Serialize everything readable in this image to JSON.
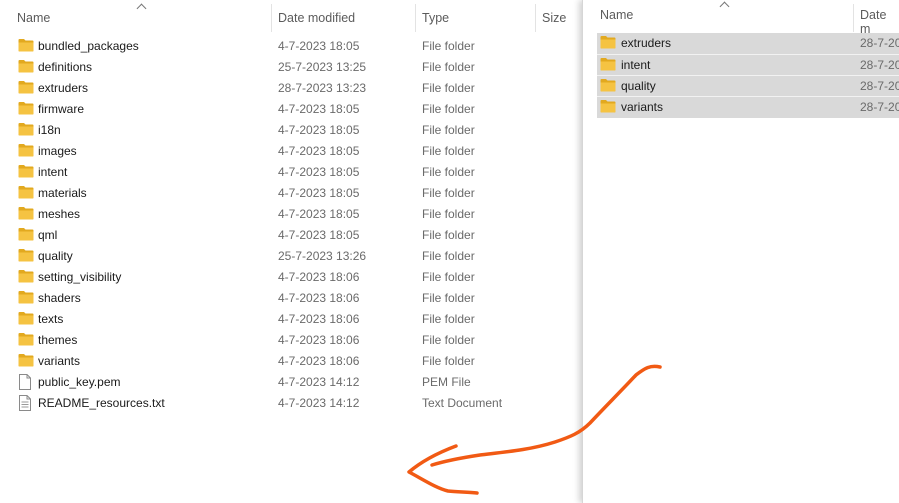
{
  "left_pane": {
    "columns": {
      "name": "Name",
      "date": "Date modified",
      "type": "Type",
      "size": "Size"
    },
    "rows": [
      {
        "icon": "folder-icon",
        "name": "bundled_packages",
        "date": "4-7-2023 18:05",
        "type": "File folder"
      },
      {
        "icon": "folder-icon",
        "name": "definitions",
        "date": "25-7-2023 13:25",
        "type": "File folder"
      },
      {
        "icon": "folder-icon",
        "name": "extruders",
        "date": "28-7-2023 13:23",
        "type": "File folder"
      },
      {
        "icon": "folder-icon",
        "name": "firmware",
        "date": "4-7-2023 18:05",
        "type": "File folder"
      },
      {
        "icon": "folder-icon",
        "name": "i18n",
        "date": "4-7-2023 18:05",
        "type": "File folder"
      },
      {
        "icon": "folder-icon",
        "name": "images",
        "date": "4-7-2023 18:05",
        "type": "File folder"
      },
      {
        "icon": "folder-icon",
        "name": "intent",
        "date": "4-7-2023 18:05",
        "type": "File folder"
      },
      {
        "icon": "folder-icon",
        "name": "materials",
        "date": "4-7-2023 18:05",
        "type": "File folder"
      },
      {
        "icon": "folder-icon",
        "name": "meshes",
        "date": "4-7-2023 18:05",
        "type": "File folder"
      },
      {
        "icon": "folder-icon",
        "name": "qml",
        "date": "4-7-2023 18:05",
        "type": "File folder"
      },
      {
        "icon": "folder-icon",
        "name": "quality",
        "date": "25-7-2023 13:26",
        "type": "File folder"
      },
      {
        "icon": "folder-icon",
        "name": "setting_visibility",
        "date": "4-7-2023 18:06",
        "type": "File folder"
      },
      {
        "icon": "folder-icon",
        "name": "shaders",
        "date": "4-7-2023 18:06",
        "type": "File folder"
      },
      {
        "icon": "folder-icon",
        "name": "texts",
        "date": "4-7-2023 18:06",
        "type": "File folder"
      },
      {
        "icon": "folder-icon",
        "name": "themes",
        "date": "4-7-2023 18:06",
        "type": "File folder"
      },
      {
        "icon": "folder-icon",
        "name": "variants",
        "date": "4-7-2023 18:06",
        "type": "File folder"
      },
      {
        "icon": "file-icon",
        "name": "public_key.pem",
        "date": "4-7-2023 14:12",
        "type": "PEM File"
      },
      {
        "icon": "text-file-icon",
        "name": "README_resources.txt",
        "date": "4-7-2023 14:12",
        "type": "Text Document"
      }
    ]
  },
  "right_pane": {
    "columns": {
      "name": "Name",
      "date": "Date m"
    },
    "rows": [
      {
        "icon": "folder-icon",
        "name": "extruders",
        "date": "28-7-20"
      },
      {
        "icon": "folder-icon",
        "name": "intent",
        "date": "28-7-20"
      },
      {
        "icon": "folder-icon",
        "name": "quality",
        "date": "28-7-20"
      },
      {
        "icon": "folder-icon",
        "name": "variants",
        "date": "28-7-20"
      }
    ]
  },
  "colors": {
    "folder": "#f5c342",
    "folder_dark": "#e2a91f",
    "selection": "#d9d9d9",
    "annotation_arrow": "#f15a14"
  }
}
